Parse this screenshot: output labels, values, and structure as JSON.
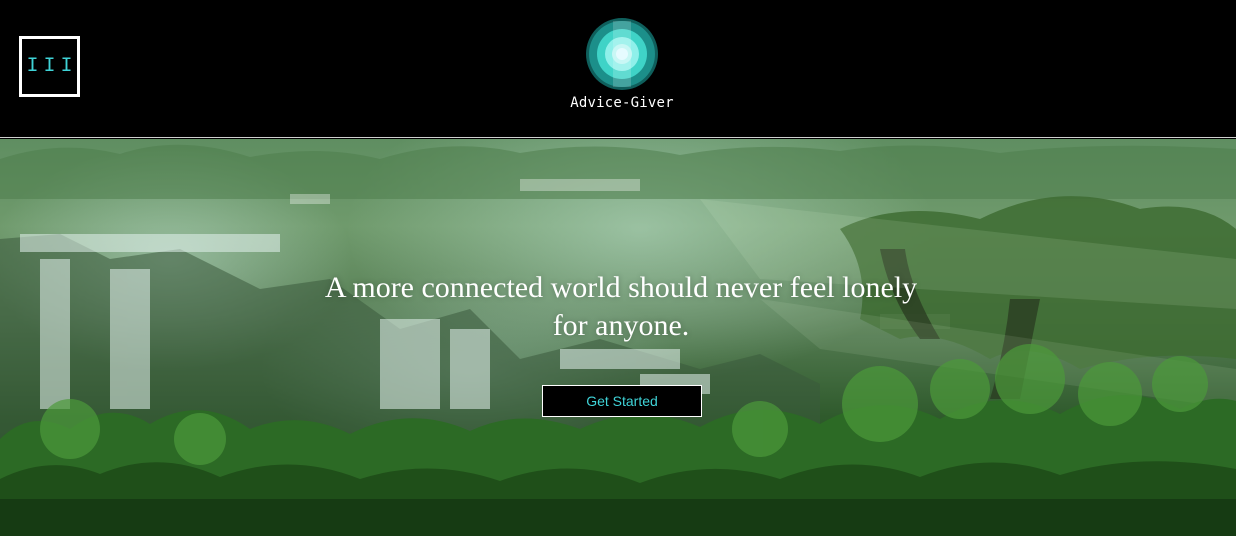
{
  "header": {
    "menu_glyph": "III",
    "brand_name": "Advice-Giver",
    "logo_colors": {
      "outer": "#1a8f8a",
      "mid": "#3fd3c7",
      "inner": "#8ff0ea",
      "core": "#e6fbff"
    }
  },
  "hero": {
    "headline": "A more connected world should never feel lonely for anyone.",
    "cta_label": "Get Started",
    "background_description_icon": "forest-waterfall-image"
  },
  "colors": {
    "accent": "#3fd3d7",
    "header_bg": "#000000",
    "button_bg": "#000000",
    "button_border": "#ffffff"
  }
}
